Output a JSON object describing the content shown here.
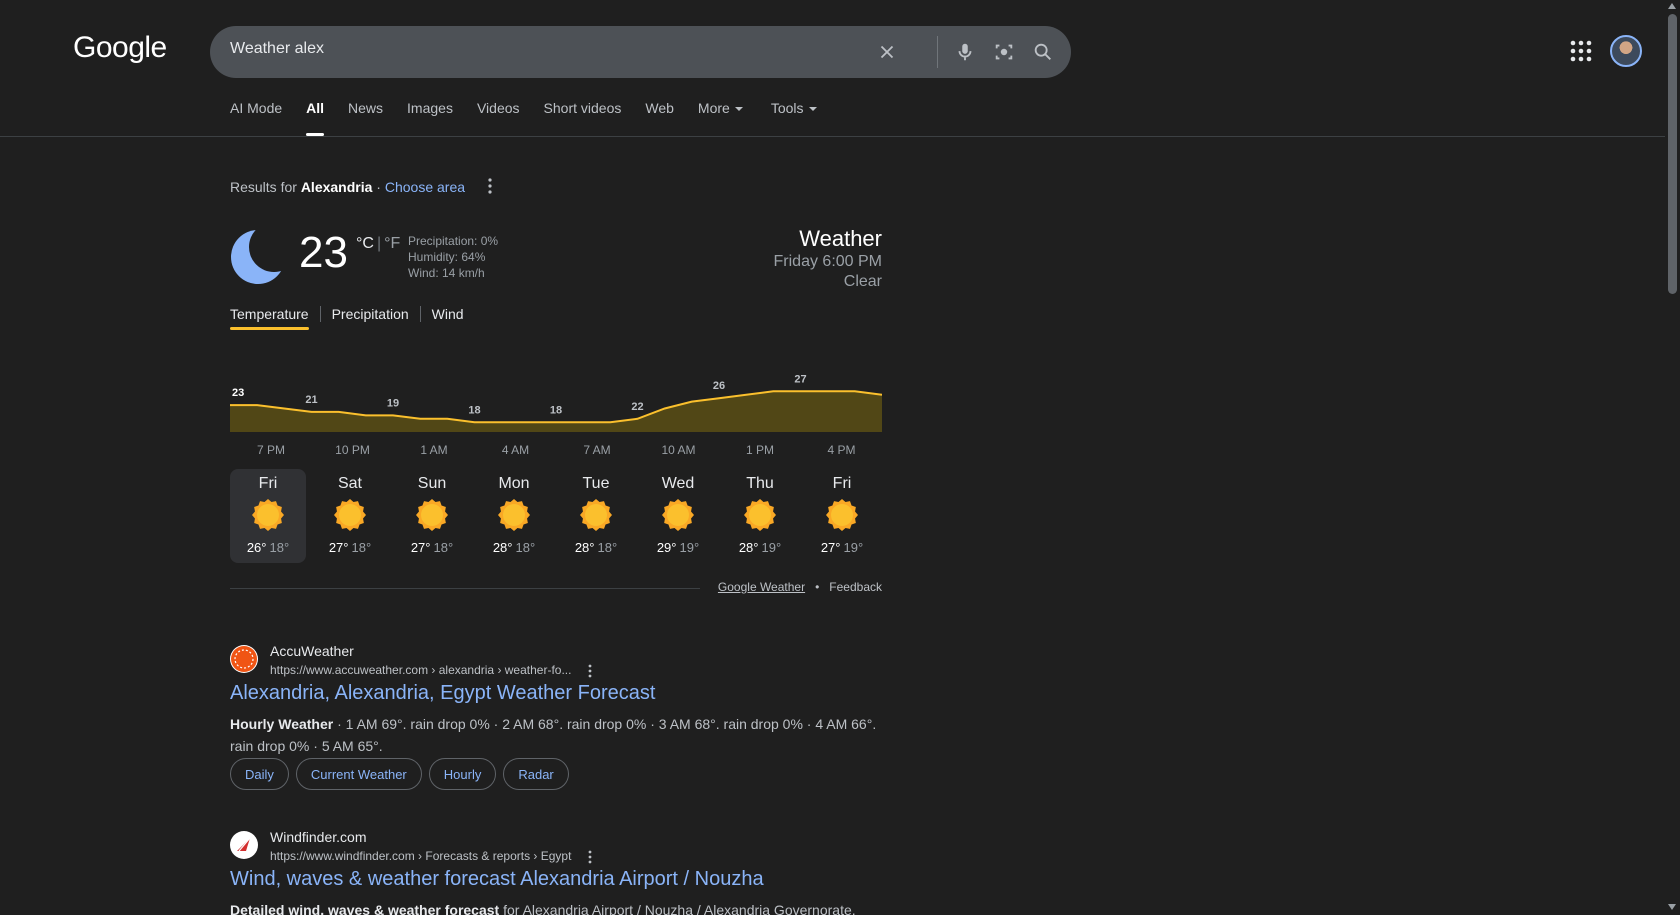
{
  "header": {
    "logo": "Google",
    "search_value": "Weather alex"
  },
  "tabs": [
    {
      "label": "AI Mode"
    },
    {
      "label": "All"
    },
    {
      "label": "News"
    },
    {
      "label": "Images"
    },
    {
      "label": "Videos"
    },
    {
      "label": "Short videos"
    },
    {
      "label": "Web"
    },
    {
      "label": "More"
    },
    {
      "label": "Tools"
    }
  ],
  "results_for": {
    "prefix": "Results for",
    "location": "Alexandria",
    "sep": "·",
    "choose": "Choose area"
  },
  "weather": {
    "temp": "23",
    "unit_c": "°C",
    "unit_f": "°F",
    "precipitation": "Precipitation: 0%",
    "humidity": "Humidity: 64%",
    "wind": "Wind: 14 km/h",
    "title": "Weather",
    "time": "Friday 6:00 PM",
    "condition": "Clear",
    "tabs": [
      "Temperature",
      "Precipitation",
      "Wind"
    ],
    "footer_link": "Google Weather",
    "footer_dot": "•",
    "feedback": "Feedback",
    "colors": {
      "accent": "#fbc02d",
      "fill": "#514716",
      "moon": "#8ab4f8",
      "sun": "#f9a825"
    }
  },
  "chart_data": {
    "type": "area",
    "x": [
      "6 PM",
      "7 PM",
      "8 PM",
      "9 PM",
      "10 PM",
      "11 PM",
      "12 AM",
      "1 AM",
      "2 AM",
      "3 AM",
      "4 AM",
      "5 AM",
      "6 AM",
      "7 AM",
      "8 AM",
      "9 AM",
      "10 AM",
      "11 AM",
      "12 PM",
      "1 PM",
      "2 PM",
      "3 PM",
      "4 PM",
      "5 PM",
      "6 PM"
    ],
    "values": [
      23,
      23,
      22,
      21,
      21,
      20,
      20,
      19,
      19,
      18,
      18,
      18,
      18,
      18,
      18,
      19,
      22,
      24,
      25,
      26,
      27,
      27,
      27,
      27,
      26
    ],
    "labels": [
      {
        "index": 0,
        "text": "23"
      },
      {
        "index": 3,
        "text": "21"
      },
      {
        "index": 6,
        "text": "19"
      },
      {
        "index": 9,
        "text": "18"
      },
      {
        "index": 12,
        "text": "18"
      },
      {
        "index": 15,
        "text": "22"
      },
      {
        "index": 18,
        "text": "26"
      },
      {
        "index": 21,
        "text": "27"
      }
    ],
    "tick_labels": [
      "7 PM",
      "10 PM",
      "1 AM",
      "4 AM",
      "7 AM",
      "10 AM",
      "1 PM",
      "4 PM"
    ],
    "ylim": [
      14,
      30
    ],
    "grid": false
  },
  "forecast": [
    {
      "day": "Fri",
      "hi": "26°",
      "lo": "18°"
    },
    {
      "day": "Sat",
      "hi": "27°",
      "lo": "18°"
    },
    {
      "day": "Sun",
      "hi": "27°",
      "lo": "18°"
    },
    {
      "day": "Mon",
      "hi": "28°",
      "lo": "18°"
    },
    {
      "day": "Tue",
      "hi": "28°",
      "lo": "18°"
    },
    {
      "day": "Wed",
      "hi": "29°",
      "lo": "19°"
    },
    {
      "day": "Thu",
      "hi": "28°",
      "lo": "19°"
    },
    {
      "day": "Fri",
      "hi": "27°",
      "lo": "19°"
    }
  ],
  "results": [
    {
      "site": "AccuWeather",
      "url": "https://www.accuweather.com › alexandria › weather-fo...",
      "title": "Alexandria, Alexandria, Egypt Weather Forecast",
      "snippet_bold": "Hourly Weather",
      "snippet": " · 1 AM 69°. rain drop 0% · 2 AM 68°. rain drop 0% · 3 AM 68°. rain drop 0% · 4 AM 66°. rain drop 0% · 5 AM 65°.",
      "chips": [
        "Daily",
        "Current Weather",
        "Hourly",
        "Radar"
      ]
    },
    {
      "site": "Windfinder.com",
      "url": "https://www.windfinder.com › Forecasts & reports › Egypt",
      "title": "Wind, waves & weather forecast Alexandria Airport / Nouzha",
      "snippet_bold": "Detailed wind, waves & weather forecast",
      "snippet": " for Alexandria Airport / Nouzha / Alexandria Governorate."
    }
  ]
}
